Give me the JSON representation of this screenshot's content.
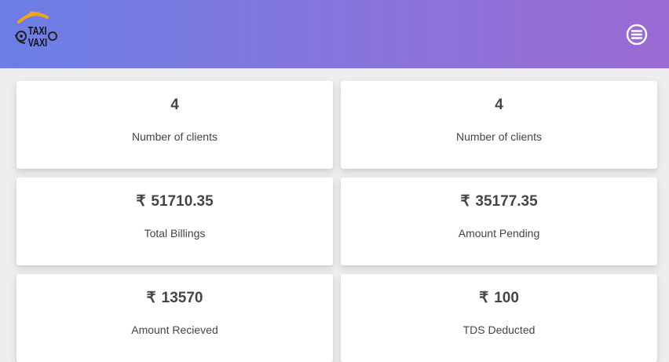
{
  "header": {
    "logo_text_top": "TAXI",
    "logo_text_bottom": "VAXI",
    "menu_icon": "menu-circle-icon",
    "gradient_start": "#6b7fe6",
    "gradient_end": "#9a6bd3"
  },
  "currency_symbol": "₹",
  "cards": [
    {
      "value": "4",
      "label": "Number of clients",
      "currency": false
    },
    {
      "value": "4",
      "label": "Number of clients",
      "currency": false
    },
    {
      "value": "51710.35",
      "label": "Total Billings",
      "currency": true
    },
    {
      "value": "35177.35",
      "label": "Amount Pending",
      "currency": true
    },
    {
      "value": "13570",
      "label": "Amount Recieved",
      "currency": true
    },
    {
      "value": "100",
      "label": "TDS Deducted",
      "currency": true
    }
  ]
}
